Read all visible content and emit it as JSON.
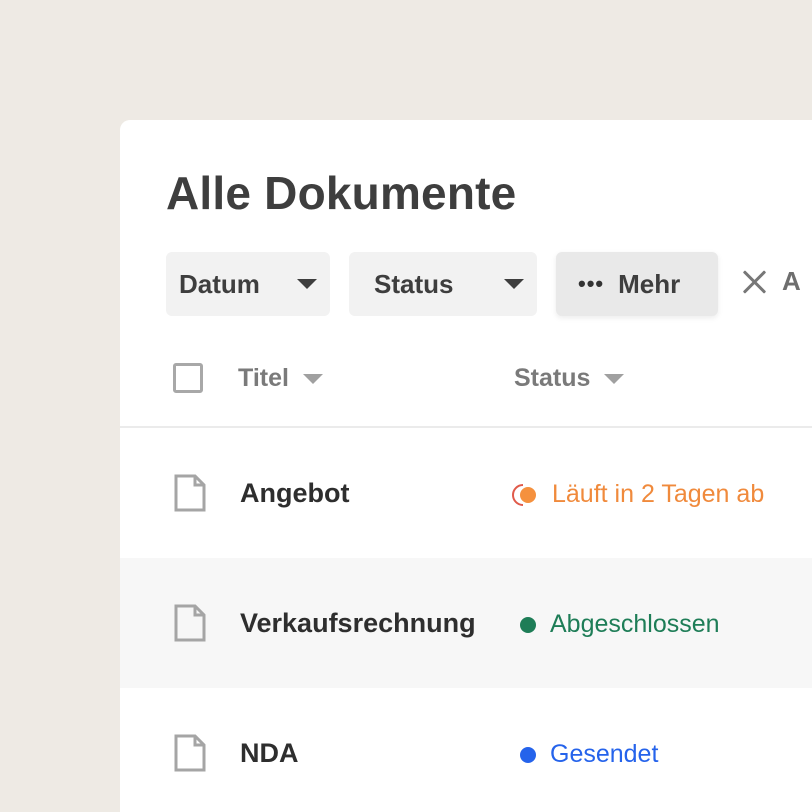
{
  "page": {
    "title": "Alle Dokumente"
  },
  "filters": {
    "datum_label": "Datum",
    "status_label": "Status",
    "more_label": "Mehr",
    "more_icon": "•••",
    "clear_label": "A"
  },
  "table": {
    "columns": [
      {
        "label": "Titel"
      },
      {
        "label": "Status"
      }
    ],
    "rows": [
      {
        "title": "Angebot",
        "status": "Läuft in 2 Tagen ab",
        "status_type": "expiring",
        "status_color": "#F08A3C"
      },
      {
        "title": "Verkaufsrechnung",
        "status": "Abgeschlossen",
        "status_type": "completed",
        "status_color": "#1E7D57"
      },
      {
        "title": "NDA",
        "status": "Gesendet",
        "status_type": "sent",
        "status_color": "#2563EB"
      }
    ]
  },
  "colors": {
    "background": "#EEEAE4",
    "panel": "#FFFFFF",
    "expiring": "#F08A3C",
    "completed": "#1E7D57",
    "sent": "#2563EB"
  },
  "icons": {
    "document": "document-icon",
    "caret": "caret-down-icon",
    "more": "more-dots-icon",
    "clear": "close-icon",
    "expiring": "expiring-clock-icon"
  }
}
